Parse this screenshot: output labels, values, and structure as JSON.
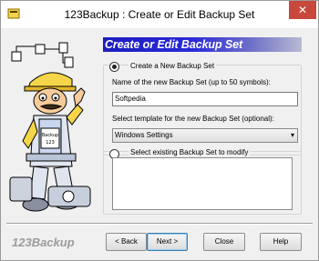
{
  "window": {
    "title": "123Backup : Create or Edit Backup Set",
    "close_glyph": "✕"
  },
  "banner": {
    "title": "Create or Edit Backup Set"
  },
  "create_group": {
    "option_label": "Create a New Backup Set",
    "name_label": "Name of the new Backup Set (up to 50 symbols):",
    "name_value": "Softpedia",
    "template_label": "Select template for the new Backup Set (optional):",
    "template_value": "Windows Settings",
    "template_arrow": "▾"
  },
  "existing_group": {
    "option_label": "Select existing Backup Set to modify"
  },
  "illustration": {
    "badge_text": "Backup 123"
  },
  "footer": {
    "brand": "123Backup",
    "back_label": "< Back",
    "next_label": "Next >",
    "close_label": "Close",
    "help_label": "Help"
  },
  "colors": {
    "banner_start": "#1d1dbf",
    "banner_end": "#b8bad2",
    "close_button": "#c9483c"
  },
  "icons": [
    "app-icon",
    "close-icon",
    "dropdown-arrow-icon",
    "mascot-illustration"
  ]
}
